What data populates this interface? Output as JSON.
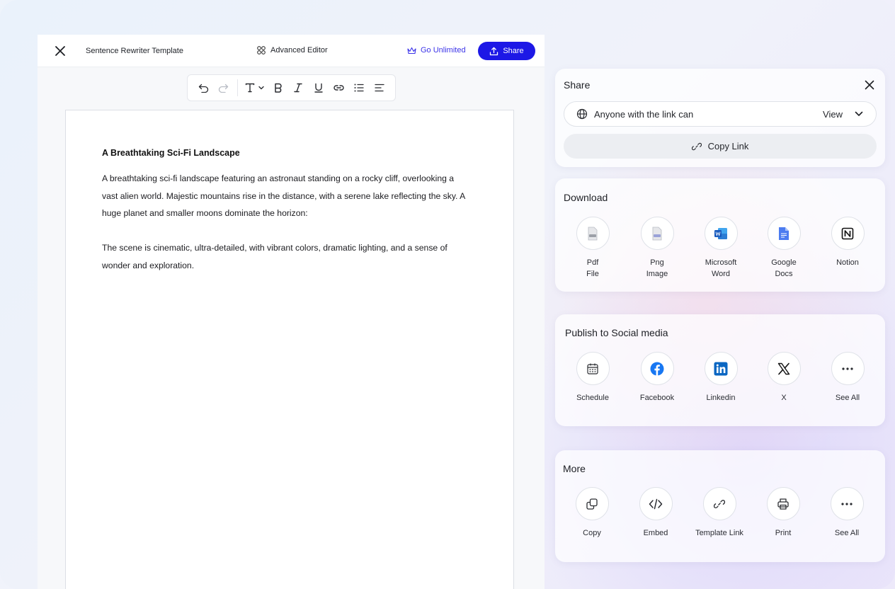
{
  "editor": {
    "title": "Sentence Rewriter Template",
    "advanced_label": "Advanced Editor",
    "unlimited_label": "Go Unlimited",
    "share_label": "Share"
  },
  "document": {
    "heading": "A Breathtaking Sci-Fi Landscape",
    "paragraphs": [
      "A breathtaking sci-fi landscape featuring an astronaut standing on a rocky cliff, overlooking a vast alien world. Majestic mountains rise in the distance, with a serene lake reflecting the sky. A huge planet and smaller moons dominate the horizon:",
      "The scene is cinematic, ultra-detailed, with vibrant colors, dramatic lighting, and a sense of wonder and exploration."
    ]
  },
  "share": {
    "title": "Share",
    "access_text": "Anyone with the link can",
    "permission": "View",
    "copy_link_label": "Copy Link"
  },
  "download": {
    "title": "Download",
    "items": [
      {
        "line1": "Pdf",
        "line2": "File",
        "icon": "pdf-file-icon"
      },
      {
        "line1": "Png",
        "line2": "Image",
        "icon": "png-image-icon"
      },
      {
        "line1": "Microsoft",
        "line2": "Word",
        "icon": "word-icon"
      },
      {
        "line1": "Google",
        "line2": "Docs",
        "icon": "google-docs-icon"
      },
      {
        "line1": "Notion",
        "line2": "",
        "icon": "notion-icon"
      }
    ]
  },
  "social": {
    "title": "Publish to Social media",
    "items": [
      {
        "label": "Schedule",
        "icon": "calendar-icon"
      },
      {
        "label": "Facebook",
        "icon": "facebook-icon"
      },
      {
        "label": "Linkedin",
        "icon": "linkedin-icon"
      },
      {
        "label": "X",
        "icon": "x-icon"
      },
      {
        "label": "See All",
        "icon": "more-icon"
      }
    ]
  },
  "more": {
    "title": "More",
    "items": [
      {
        "label": "Copy",
        "icon": "copy-icon"
      },
      {
        "label": "Embed",
        "icon": "embed-icon"
      },
      {
        "label": "Template Link",
        "icon": "link-icon"
      },
      {
        "label": "Print",
        "icon": "printer-icon"
      },
      {
        "label": "See All",
        "icon": "more-icon"
      }
    ]
  },
  "colors": {
    "accent": "#1d18e6",
    "facebook": "#1877f2",
    "linkedin": "#0a66c2",
    "word": "#185abd",
    "docs": "#4c7cf0"
  }
}
